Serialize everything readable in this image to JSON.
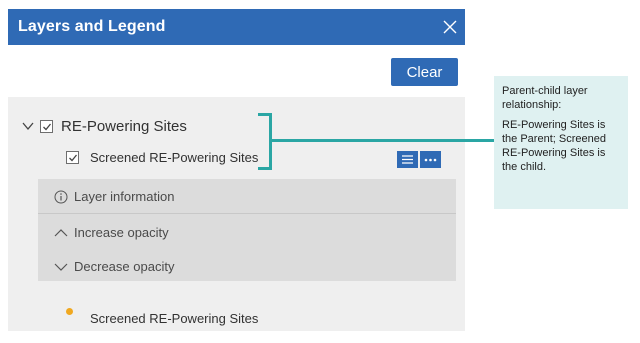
{
  "panel": {
    "title": "Layers and Legend",
    "close_icon": "close-icon"
  },
  "toolbar": {
    "clear_label": "Clear"
  },
  "layers": {
    "parent_label": "RE-Powering Sites",
    "child_label": "Screened RE-Powering Sites"
  },
  "menu": {
    "layer_info": "Layer information",
    "increase_opacity": "Increase opacity",
    "decrease_opacity": "Decrease opacity"
  },
  "legend": {
    "item_label": "Screened RE-Powering Sites",
    "dot_color": "#f0a820"
  },
  "annotation": {
    "heading": "Parent-child layer relationship:",
    "body": "RE-Powering Sites is the Parent; Screened RE-Powering Sites is the child.",
    "accent_color": "#2aa6a4"
  },
  "colors": {
    "brand": "#2f6ab5",
    "list_bg": "#efefef",
    "menu_bg": "#dcdcdc"
  }
}
